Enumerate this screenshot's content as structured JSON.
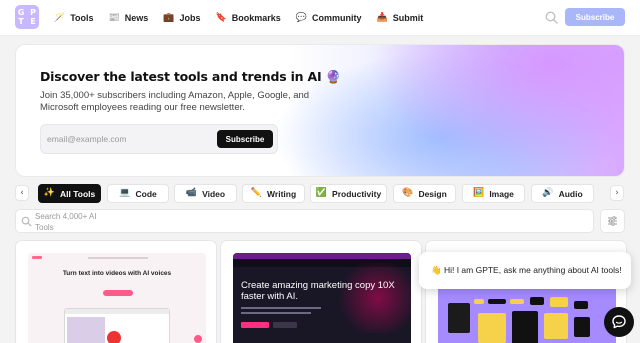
{
  "nav": {
    "logo_text": [
      "G",
      "P",
      "T",
      "E"
    ],
    "links": [
      {
        "icon": "🪄",
        "icon_name": "magic-wand-icon",
        "label": "Tools"
      },
      {
        "icon": "📰",
        "icon_name": "newspaper-icon",
        "label": "News"
      },
      {
        "icon": "💼",
        "icon_name": "briefcase-icon",
        "label": "Jobs"
      },
      {
        "icon": "🔖",
        "icon_name": "bookmark-icon",
        "label": "Bookmarks"
      },
      {
        "icon": "💬",
        "icon_name": "speech-bubble-icon",
        "label": "Community"
      },
      {
        "icon": "📥",
        "icon_name": "inbox-tray-icon",
        "label": "Submit"
      }
    ],
    "subscribe_label": "Subscribe"
  },
  "hero": {
    "title": "Discover the latest tools and trends in AI 🔮",
    "subtitle": "Join 35,000+ subscribers including Amazon, Apple, Google, and Microsoft employees reading our free newsletter.",
    "email_placeholder": "email@example.com",
    "subscribe_label": "Subscribe"
  },
  "categories": [
    {
      "icon": "✨",
      "label": "All Tools",
      "active": true
    },
    {
      "icon": "💻",
      "label": "Code",
      "active": false
    },
    {
      "icon": "📹",
      "label": "Video",
      "active": false
    },
    {
      "icon": "✏️",
      "label": "Writing",
      "active": false
    },
    {
      "icon": "✅",
      "label": "Productivity",
      "active": false
    },
    {
      "icon": "🎨",
      "label": "Design",
      "active": false
    },
    {
      "icon": "🖼️",
      "label": "Image",
      "active": false
    },
    {
      "icon": "🔊",
      "label": "Audio",
      "active": false
    }
  ],
  "search": {
    "placeholder": "Search 4,000+ AI Tools"
  },
  "cards": [
    {
      "headline": "Turn text into videos with AI voices"
    },
    {
      "headline": "Create amazing marketing copy 10X faster with AI."
    },
    {
      "headline": ""
    }
  ],
  "chat": {
    "message": "👋 Hi! I am GPTE, ask me anything about AI tools!"
  },
  "colors": {
    "accent": "#a9b6f9",
    "dark": "#111111",
    "hero_purple": "#d9a9ff"
  }
}
